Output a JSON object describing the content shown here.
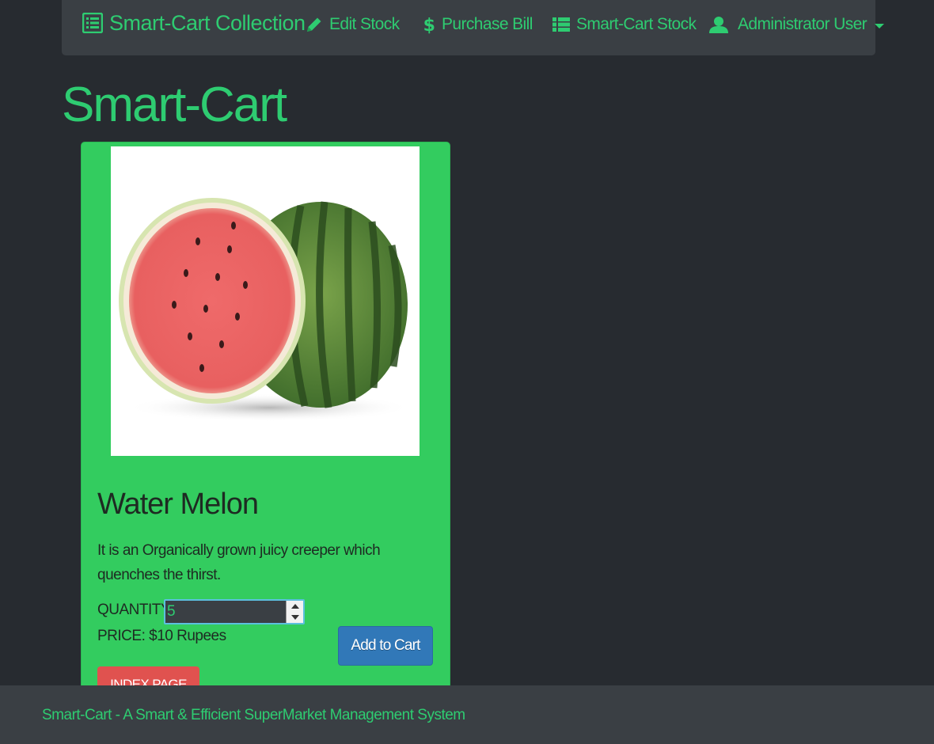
{
  "navbar": {
    "brand": "Smart-Cart Collection",
    "edit_stock": "Edit Stock",
    "purchase_bill": "Purchase Bill",
    "stock": "Smart-Cart Stock",
    "user": "Administrator User"
  },
  "page": {
    "title": "Smart-Cart"
  },
  "product": {
    "name": "Water Melon",
    "description": "It is an Organically grown juicy creeper which quenches the thirst.",
    "quantity_label": "QUANTITY:",
    "quantity_value": "5",
    "price_label": "PRICE: $10 Rupees",
    "add_to_cart": "Add to Cart",
    "index_page": "INDEX PAGE"
  },
  "footer": {
    "text": "Smart-Cart - A Smart & Efficient SuperMarket Management System"
  },
  "colors": {
    "accent": "#2ecc71",
    "background": "#272b30",
    "navbar": "#3a3f44",
    "card": "#33cc5f",
    "primary_button": "#3178b8",
    "danger_button": "#e0524f"
  },
  "icons": {
    "brand": "list-icon",
    "edit_stock": "pencil-icon",
    "purchase_bill": "dollar-icon",
    "stock": "th-list-icon",
    "user": "user-icon",
    "dropdown": "caret-down-icon"
  }
}
